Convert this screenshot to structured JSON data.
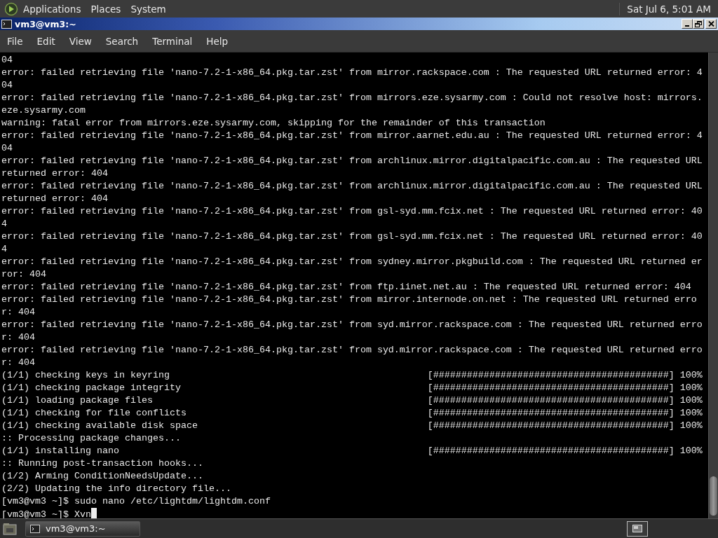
{
  "top_panel": {
    "menus": [
      "Applications",
      "Places",
      "System"
    ],
    "clock": "Sat Jul  6,  5:01 AM"
  },
  "window": {
    "title": "vm3@vm3:~"
  },
  "menu_bar": [
    "File",
    "Edit",
    "View",
    "Search",
    "Terminal",
    "Help"
  ],
  "terminal": {
    "lines": [
      {
        "kind": "text",
        "text": "04"
      },
      {
        "kind": "text",
        "text": "error: failed retrieving file 'nano-7.2-1-x86_64.pkg.tar.zst' from mirror.rackspace.com : The requested URL returned error: 404"
      },
      {
        "kind": "text",
        "text": "error: failed retrieving file 'nano-7.2-1-x86_64.pkg.tar.zst' from mirrors.eze.sysarmy.com : Could not resolve host: mirrors.eze.sysarmy.com"
      },
      {
        "kind": "text",
        "text": "warning: fatal error from mirrors.eze.sysarmy.com, skipping for the remainder of this transaction"
      },
      {
        "kind": "text",
        "text": "error: failed retrieving file 'nano-7.2-1-x86_64.pkg.tar.zst' from mirror.aarnet.edu.au : The requested URL returned error: 404"
      },
      {
        "kind": "text",
        "text": "error: failed retrieving file 'nano-7.2-1-x86_64.pkg.tar.zst' from archlinux.mirror.digitalpacific.com.au : The requested URL returned error: 404"
      },
      {
        "kind": "text",
        "text": "error: failed retrieving file 'nano-7.2-1-x86_64.pkg.tar.zst' from archlinux.mirror.digitalpacific.com.au : The requested URL returned error: 404"
      },
      {
        "kind": "text",
        "text": "error: failed retrieving file 'nano-7.2-1-x86_64.pkg.tar.zst' from gsl-syd.mm.fcix.net : The requested URL returned error: 404"
      },
      {
        "kind": "text",
        "text": "error: failed retrieving file 'nano-7.2-1-x86_64.pkg.tar.zst' from gsl-syd.mm.fcix.net : The requested URL returned error: 404"
      },
      {
        "kind": "text",
        "text": "error: failed retrieving file 'nano-7.2-1-x86_64.pkg.tar.zst' from sydney.mirror.pkgbuild.com : The requested URL returned error: 404"
      },
      {
        "kind": "text",
        "text": "error: failed retrieving file 'nano-7.2-1-x86_64.pkg.tar.zst' from ftp.iinet.net.au : The requested URL returned error: 404"
      },
      {
        "kind": "text",
        "text": "error: failed retrieving file 'nano-7.2-1-x86_64.pkg.tar.zst' from mirror.internode.on.net : The requested URL returned error: 404"
      },
      {
        "kind": "text",
        "text": "error: failed retrieving file 'nano-7.2-1-x86_64.pkg.tar.zst' from syd.mirror.rackspace.com : The requested URL returned error: 404"
      },
      {
        "kind": "text",
        "text": "error: failed retrieving file 'nano-7.2-1-x86_64.pkg.tar.zst' from syd.mirror.rackspace.com : The requested URL returned error: 404"
      },
      {
        "kind": "progress",
        "label": "(1/1) checking keys in keyring",
        "bar": "[##########################################]",
        "percent": "100%"
      },
      {
        "kind": "progress",
        "label": "(1/1) checking package integrity",
        "bar": "[##########################################]",
        "percent": "100%"
      },
      {
        "kind": "progress",
        "label": "(1/1) loading package files",
        "bar": "[##########################################]",
        "percent": "100%"
      },
      {
        "kind": "progress",
        "label": "(1/1) checking for file conflicts",
        "bar": "[##########################################]",
        "percent": "100%"
      },
      {
        "kind": "progress",
        "label": "(1/1) checking available disk space",
        "bar": "[##########################################]",
        "percent": "100%"
      },
      {
        "kind": "text",
        "text": ":: Processing package changes..."
      },
      {
        "kind": "progress",
        "label": "(1/1) installing nano",
        "bar": "[##########################################]",
        "percent": "100%"
      },
      {
        "kind": "text",
        "text": ":: Running post-transaction hooks..."
      },
      {
        "kind": "text",
        "text": "(1/2) Arming ConditionNeedsUpdate..."
      },
      {
        "kind": "text",
        "text": "(2/2) Updating the info directory file..."
      },
      {
        "kind": "prompt",
        "text": "[vm3@vm3 ~]$ sudo nano /etc/lightdm/lightdm.conf",
        "cursor": false
      },
      {
        "kind": "prompt",
        "text": "[vm3@vm3 ~]$ Xvn",
        "cursor": true
      }
    ]
  },
  "taskbar": {
    "tasks": [
      {
        "label": "vm3@vm3:~",
        "selected": true
      }
    ]
  }
}
